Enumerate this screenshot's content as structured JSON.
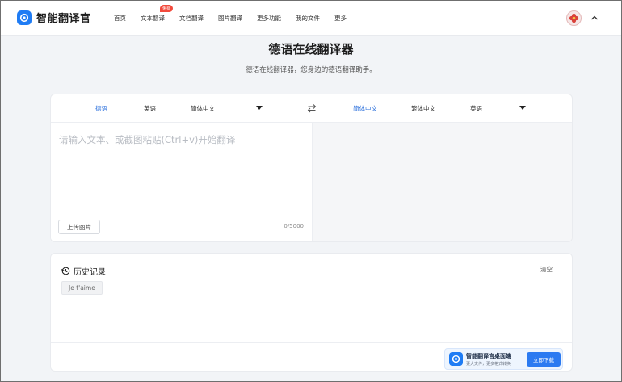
{
  "header": {
    "app_title": "智能翻译官",
    "nav": [
      {
        "label": "首页"
      },
      {
        "label": "文本翻译",
        "badge": "免费"
      },
      {
        "label": "文档翻译"
      },
      {
        "label": "图片翻译"
      },
      {
        "label": "更多功能"
      },
      {
        "label": "我的文件"
      },
      {
        "label": "更多"
      }
    ],
    "brand_color": "#1f7cf4",
    "badge_color": "#f24a3c"
  },
  "main": {
    "title": "德语在线翻译器",
    "subtitle": "德语在线翻译器，您身边的德语翻译助手。"
  },
  "translator": {
    "source_languages": [
      "德语",
      "英语",
      "简体中文"
    ],
    "source_selected": "德语",
    "target_languages": [
      "简体中文",
      "繁体中文",
      "英语"
    ],
    "target_selected": "简体中文",
    "source_placeholder": "请输入文本、或截图粘贴(Ctrl+v)开始翻译",
    "upload_label": "上传图片",
    "char_count": "0/5000",
    "active_color": "#2a6fdc"
  },
  "history": {
    "title": "历史记录",
    "clear_label": "清空",
    "items": [
      "Je t'aime"
    ]
  },
  "promo": {
    "title": "智能翻译官桌面端",
    "subtitle": "更大文件，更多格式转换",
    "button_label": "立即下载"
  }
}
